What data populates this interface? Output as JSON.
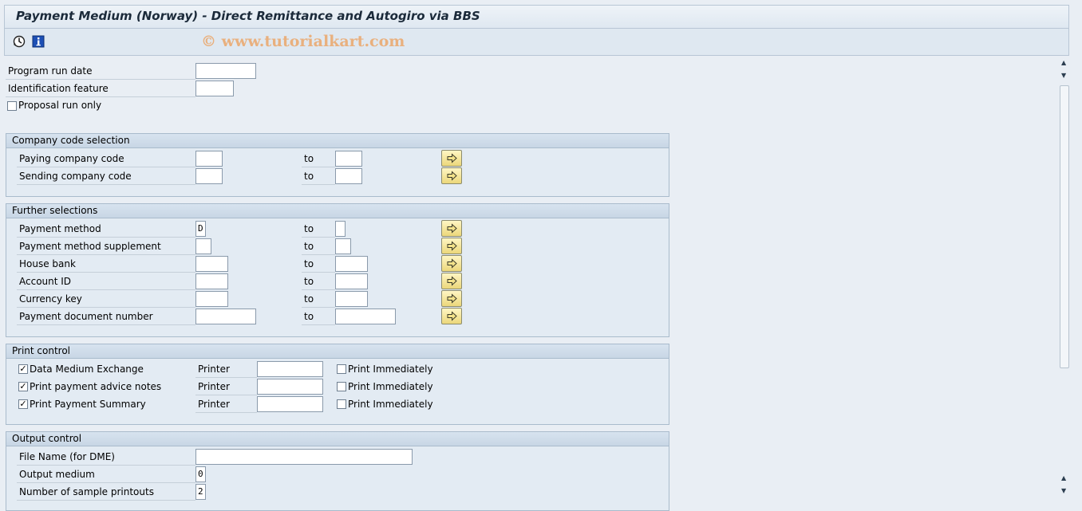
{
  "window": {
    "title": "Payment Medium (Norway) - Direct Remittance and Autogiro via BBS"
  },
  "toolbar": {
    "icons": [
      "execute-icon",
      "info-icon"
    ],
    "watermark": "© www.tutorialkart.com"
  },
  "main": {
    "program_run_date": {
      "label": "Program run date",
      "value": ""
    },
    "identification_feature": {
      "label": "Identification feature",
      "value": ""
    },
    "proposal_run_only": {
      "label": "Proposal run only",
      "checked": false
    }
  },
  "company_code_selection": {
    "title": "Company code selection",
    "rows": [
      {
        "label": "Paying company code",
        "to_label": "to",
        "from": "",
        "to": ""
      },
      {
        "label": "Sending company code",
        "to_label": "to",
        "from": "",
        "to": ""
      }
    ]
  },
  "further_selections": {
    "title": "Further selections",
    "rows": [
      {
        "label": "Payment method",
        "to_label": "to",
        "from": "D",
        "to": ""
      },
      {
        "label": "Payment method supplement",
        "to_label": "to",
        "from": "",
        "to": ""
      },
      {
        "label": "House bank",
        "to_label": "to",
        "from": "",
        "to": ""
      },
      {
        "label": "Account ID",
        "to_label": "to",
        "from": "",
        "to": ""
      },
      {
        "label": "Currency key",
        "to_label": "to",
        "from": "",
        "to": ""
      },
      {
        "label": "Payment document number",
        "to_label": "to",
        "from": "",
        "to": ""
      }
    ]
  },
  "print_control": {
    "title": "Print control",
    "rows": [
      {
        "label": "Data Medium Exchange",
        "checked": true,
        "printer_label": "Printer",
        "printer": "",
        "print_immediately_label": "Print Immediately",
        "print_immediately": false
      },
      {
        "label": "Print payment advice notes",
        "checked": true,
        "printer_label": "Printer",
        "printer": "",
        "print_immediately_label": "Print Immediately",
        "print_immediately": false
      },
      {
        "label": "Print Payment Summary",
        "checked": true,
        "printer_label": "Printer",
        "printer": "",
        "print_immediately_label": "Print Immediately",
        "print_immediately": false
      }
    ]
  },
  "output_control": {
    "title": "Output control",
    "file_name": {
      "label": "File Name (for DME)",
      "value": ""
    },
    "output_medium": {
      "label": "Output medium",
      "value": "0"
    },
    "sample_printouts": {
      "label": "Number of sample printouts",
      "value": "2"
    }
  },
  "check_mark": "✓",
  "colors": {
    "accent_yellow": "#ecd77a",
    "group_header": "#c8d6e5",
    "background": "#e9eef4"
  }
}
